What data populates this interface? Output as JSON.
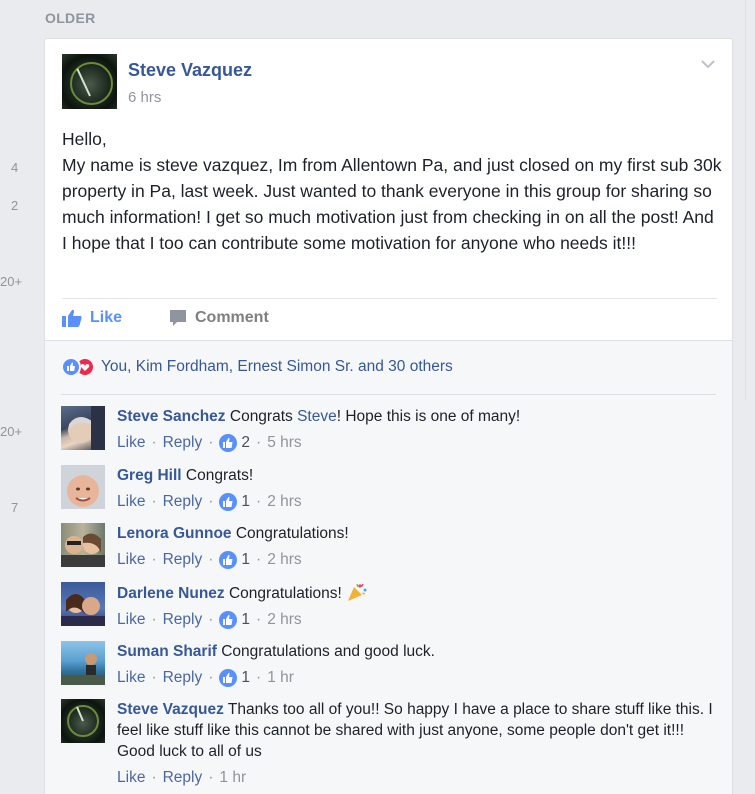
{
  "section_label": "OLDER",
  "left_counts": [
    "4",
    "2",
    "20+",
    "20+",
    "7"
  ],
  "post": {
    "author": "Steve Vazquez",
    "time": "6 hrs",
    "lines": [
      "Hello,",
      "My name is steve vazquez, Im from Allentown Pa, and just closed on my first sub 30k property in Pa, last week. Just wanted to thank everyone in this group for sharing so much information! I get so much motivation just from checking in on all the post! And I hope that I too can contribute some motivation for anyone who needs it!!!"
    ],
    "actions": {
      "like": "Like",
      "comment": "Comment"
    },
    "reactions_text": "You, Kim Fordham, Ernest Simon Sr. and 30 others",
    "colors": {
      "accent": "#365899",
      "like_blue": "#5890ff",
      "love_red": "#f0284a"
    }
  },
  "comments": [
    {
      "name": "Steve Sanchez",
      "text_before": "Congrats ",
      "mention": "Steve",
      "text_after": "! Hope this is one of many!",
      "like": "Like",
      "reply": "Reply",
      "likes": "2",
      "time": "5 hrs",
      "avatar": "avatar-steve-sanchez"
    },
    {
      "name": "Greg Hill",
      "text_before": "Congrats!",
      "mention": "",
      "text_after": "",
      "like": "Like",
      "reply": "Reply",
      "likes": "1",
      "time": "2 hrs",
      "avatar": "avatar-greg-hill"
    },
    {
      "name": "Lenora Gunnoe",
      "text_before": "Congratulations!",
      "mention": "",
      "text_after": "",
      "like": "Like",
      "reply": "Reply",
      "likes": "1",
      "time": "2 hrs",
      "avatar": "avatar-lenora-gunnoe"
    },
    {
      "name": "Darlene Nunez",
      "text_before": "Congratulations! ",
      "mention": "",
      "text_after": "",
      "like": "Like",
      "reply": "Reply",
      "likes": "1",
      "time": "2 hrs",
      "avatar": "avatar-darlene-nunez",
      "emoji": "party-popper-icon"
    },
    {
      "name": "Suman Sharif",
      "text_before": "Congratulations and good luck.",
      "mention": "",
      "text_after": "",
      "like": "Like",
      "reply": "Reply",
      "likes": "1",
      "time": "1 hr",
      "avatar": "avatar-suman-sharif"
    },
    {
      "name": "Steve Vazquez",
      "text_before": "Thanks too all of you!! So happy I have a place to share stuff like this. I feel like stuff like this cannot be shared with just anyone, some people don't get it!!! Good luck to all of us",
      "mention": "",
      "text_after": "",
      "like": "Like",
      "reply": "Reply",
      "likes": "",
      "time": "1 hr",
      "avatar": "avatar-steve-vazquez"
    }
  ]
}
